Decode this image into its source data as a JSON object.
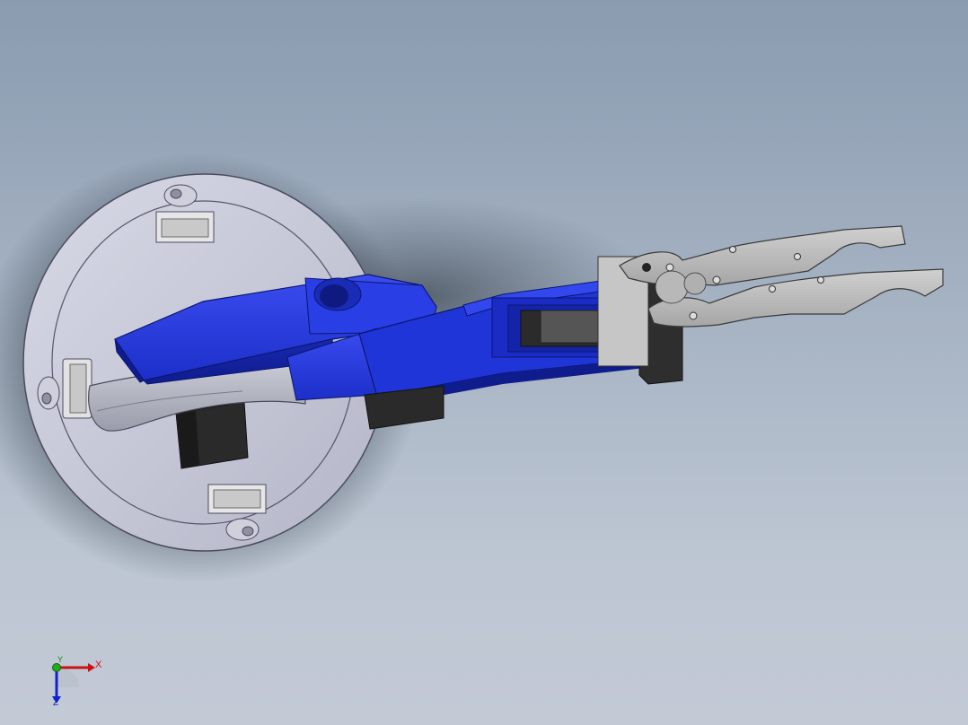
{
  "viewport": {
    "background_top": "#8a9bb0",
    "background_bottom": "#c3cad6"
  },
  "model": {
    "parts": [
      {
        "name": "base-plate",
        "color": "#c8cad8"
      },
      {
        "name": "upper-arm",
        "color": "#1f33d6"
      },
      {
        "name": "forearm",
        "color": "#2238e0"
      },
      {
        "name": "servo",
        "color": "#2b2b2b"
      },
      {
        "name": "gripper",
        "color": "#bcbcbc"
      }
    ]
  },
  "triad": {
    "x_label": "X",
    "y_label": "Y",
    "z_label": "Z",
    "x_color": "#cc1111",
    "y_color": "#118811",
    "z_color": "#1122cc"
  }
}
